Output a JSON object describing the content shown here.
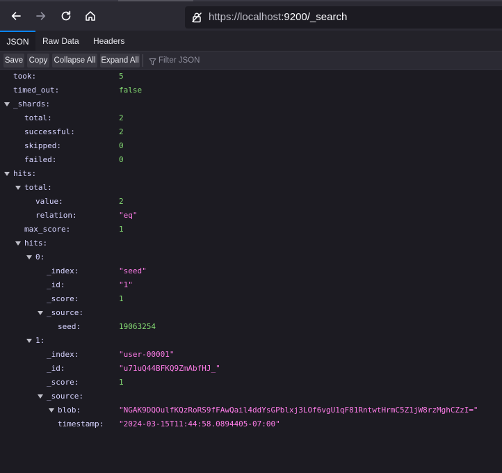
{
  "browser": {
    "url_host": "https://localhost",
    "url_rest": ":9200/_search"
  },
  "viewer_tabs": [
    {
      "label": "JSON",
      "active": true
    },
    {
      "label": "Raw Data",
      "active": false
    },
    {
      "label": "Headers",
      "active": false
    }
  ],
  "json_toolbar": {
    "save": "Save",
    "copy": "Copy",
    "collapse_all": "Collapse All",
    "expand_all": "Expand All",
    "filter_placeholder": "Filter JSON"
  },
  "tree": [
    {
      "key": "took:",
      "value": "5",
      "type": "num",
      "depth": 0,
      "expandable": false
    },
    {
      "key": "timed_out:",
      "value": "false",
      "type": "bool",
      "depth": 0,
      "expandable": false
    },
    {
      "key": "_shards:",
      "value": "",
      "type": "obj",
      "depth": 0,
      "expandable": true
    },
    {
      "key": "total:",
      "value": "2",
      "type": "num",
      "depth": 1,
      "expandable": false
    },
    {
      "key": "successful:",
      "value": "2",
      "type": "num",
      "depth": 1,
      "expandable": false
    },
    {
      "key": "skipped:",
      "value": "0",
      "type": "num",
      "depth": 1,
      "expandable": false
    },
    {
      "key": "failed:",
      "value": "0",
      "type": "num",
      "depth": 1,
      "expandable": false
    },
    {
      "key": "hits:",
      "value": "",
      "type": "obj",
      "depth": 0,
      "expandable": true
    },
    {
      "key": "total:",
      "value": "",
      "type": "obj",
      "depth": 1,
      "expandable": true
    },
    {
      "key": "value:",
      "value": "2",
      "type": "num",
      "depth": 2,
      "expandable": false
    },
    {
      "key": "relation:",
      "value": "\"eq\"",
      "type": "str",
      "depth": 2,
      "expandable": false
    },
    {
      "key": "max_score:",
      "value": "1",
      "type": "num",
      "depth": 1,
      "expandable": false
    },
    {
      "key": "hits:",
      "value": "",
      "type": "obj",
      "depth": 1,
      "expandable": true
    },
    {
      "key": "0:",
      "value": "",
      "type": "obj",
      "depth": 2,
      "expandable": true
    },
    {
      "key": "_index:",
      "value": "\"seed\"",
      "type": "str",
      "depth": 3,
      "expandable": false
    },
    {
      "key": "_id:",
      "value": "\"1\"",
      "type": "str",
      "depth": 3,
      "expandable": false
    },
    {
      "key": "_score:",
      "value": "1",
      "type": "num",
      "depth": 3,
      "expandable": false
    },
    {
      "key": "_source:",
      "value": "",
      "type": "obj",
      "depth": 3,
      "expandable": true
    },
    {
      "key": "seed:",
      "value": "19063254",
      "type": "num",
      "depth": 4,
      "expandable": false
    },
    {
      "key": "1:",
      "value": "",
      "type": "obj",
      "depth": 2,
      "expandable": true
    },
    {
      "key": "_index:",
      "value": "\"user-00001\"",
      "type": "str",
      "depth": 3,
      "expandable": false
    },
    {
      "key": "_id:",
      "value": "\"u71uQ44BFKQ9ZmAbfHJ_\"",
      "type": "str",
      "depth": 3,
      "expandable": false
    },
    {
      "key": "_score:",
      "value": "1",
      "type": "num",
      "depth": 3,
      "expandable": false
    },
    {
      "key": "_source:",
      "value": "",
      "type": "obj",
      "depth": 3,
      "expandable": true
    },
    {
      "key": "blob:",
      "value": "\"NGAK9DQOulfKQzRoRS9fFAwQail4ddYsGPblxj3LOf6vgU1qF81RntwtHrmC5Z1jW8rzMghCZzI=\"",
      "type": "str",
      "depth": 4,
      "expandable": true
    },
    {
      "key": "timestamp:",
      "value": "\"2024-03-15T11:44:58.0894405-07:00\"",
      "type": "str",
      "depth": 4,
      "expandable": false
    }
  ]
}
